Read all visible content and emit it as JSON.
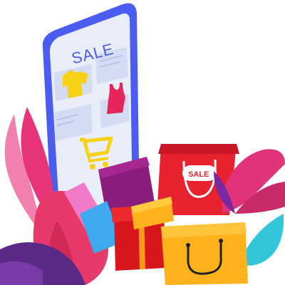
{
  "phone": {
    "screen_title": "SALE",
    "icons": [
      "tshirt-icon",
      "tank-top-icon",
      "shopping-cart-icon"
    ]
  },
  "bags": {
    "red_bag_label": "SALE"
  },
  "colors": {
    "phone_frame": "#4a5df0",
    "phone_screen": "#e9edf8",
    "tshirt": "#f7d117",
    "tank_top": "#e6255c",
    "cart": "#f7d117",
    "red_bag": "#e8222e",
    "orange_bag": "#ffb21c",
    "gift_box_red": "#d8161d",
    "gift_box_lid": "#ffb21c",
    "leaf_pink": "#e8347a",
    "leaf_purple": "#5b2a86",
    "leaf_teal": "#33c6da"
  }
}
